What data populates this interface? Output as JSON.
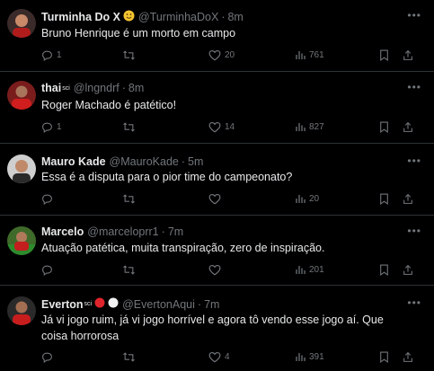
{
  "tweets": [
    {
      "name": "Turminha Do X",
      "handle": "@TurminhaDoX",
      "time": "8m",
      "badge": "smile-emoji",
      "text": "Bruno Henrique é um morto em campo",
      "replies": "1",
      "retweets": "",
      "likes": "20",
      "views": "761"
    },
    {
      "name": "thai",
      "name_badge": "sci",
      "handle": "@lngndrf",
      "time": "8m",
      "text": "Roger Machado é patético!",
      "replies": "1",
      "retweets": "",
      "likes": "14",
      "views": "827"
    },
    {
      "name": "Mauro Kade",
      "handle": "@MauroKade",
      "time": "5m",
      "text": "Essa é a disputa para o pior time do campeonato?",
      "replies": "",
      "retweets": "",
      "likes": "",
      "views": "20"
    },
    {
      "name": "Marcelo",
      "handle": "@marceloprr1",
      "time": "7m",
      "text": "Atuação patética, muita transpiração, zero de inspiração.",
      "replies": "",
      "retweets": "",
      "likes": "",
      "views": "201"
    },
    {
      "name": "Everton",
      "name_badge": "sci",
      "handle": "@EvertonAqui",
      "time": "7m",
      "badge": "red-white-circles",
      "text": "Já vi jogo ruim, já vi jogo horrível e agora tô vendo esse jogo aí. Que coisa horrorosa",
      "replies": "",
      "retweets": "",
      "likes": "4",
      "views": "391"
    }
  ],
  "colors": {
    "background": "#000000",
    "text": "#e7e9ea",
    "muted": "#71767b",
    "divider": "#2f3336"
  },
  "icons": [
    "reply-icon",
    "retweet-icon",
    "like-icon",
    "views-icon",
    "bookmark-icon",
    "share-icon",
    "more-icon"
  ]
}
